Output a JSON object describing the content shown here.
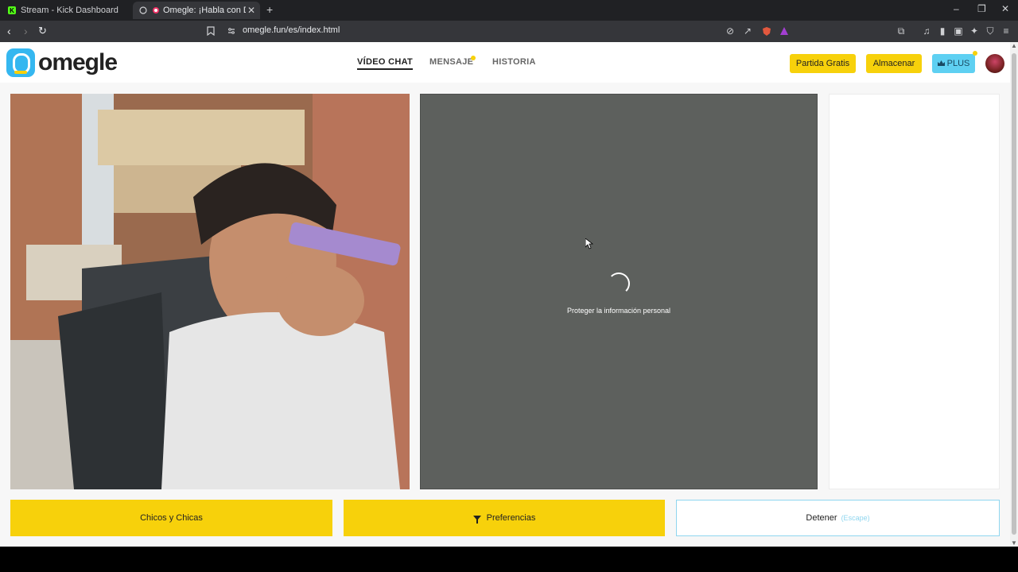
{
  "browser": {
    "tabs": [
      {
        "title": "Stream - Kick Dashboard",
        "active": false
      },
      {
        "title": "Omegle: ¡Habla con Desconocidos!",
        "active": true
      }
    ],
    "url": "omegle.fun/es/index.html",
    "window_controls": {
      "minimize": "–",
      "restore": "❐",
      "close": "✕"
    }
  },
  "header": {
    "logo_text": "omegle",
    "nav": [
      {
        "label": "VÍDEO CHAT",
        "active": true
      },
      {
        "label": "MENSAJE",
        "active": false,
        "badge_dot": true
      },
      {
        "label": "HISTORIA",
        "active": false
      }
    ],
    "buttons": {
      "free_match": "Partida Gratis",
      "store": "Almacenar",
      "plus": "PLUS"
    }
  },
  "stranger_panel": {
    "status_text": "Proteger la información personal"
  },
  "bottom_bar": {
    "gender_filter": "Chicos y Chicas",
    "preferences": "Preferencias",
    "stop": "Detener",
    "stop_hint": "(Escape)"
  },
  "colors": {
    "brand_yellow": "#f7d10b",
    "brand_blue": "#35b7f0",
    "plus_blue": "#5ed0f2",
    "stranger_bg": "#5d605d"
  }
}
